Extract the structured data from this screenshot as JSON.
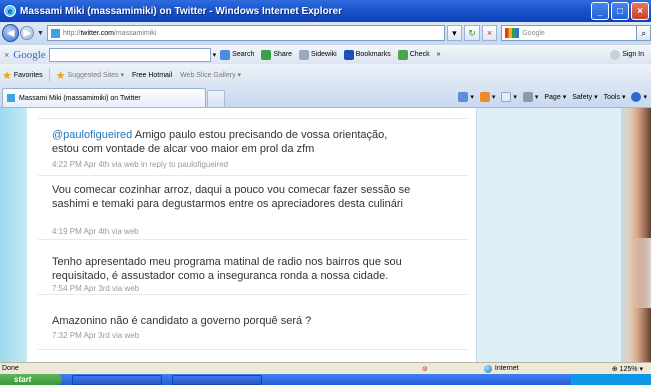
{
  "window": {
    "title": "Massami Miki (massamimiki) on Twitter - Windows Internet Explorer"
  },
  "address": {
    "url_prefix": "http://",
    "url_host": "twitter.com",
    "url_path": "/massamimiki",
    "search_placeholder": "Google"
  },
  "google_toolbar": {
    "logo": "Google",
    "items": [
      "Search",
      "Share",
      "Sidewiki",
      "Bookmarks",
      "Check",
      "»"
    ],
    "sign_in": "Sign In"
  },
  "favorites": {
    "label": "Favorites",
    "items": [
      "Suggested Sites",
      "Free Hotmail",
      "Web Slice Gallery"
    ]
  },
  "tab": {
    "title": "Massami Miki (massamimiki) on Twitter"
  },
  "command_bar": {
    "items": [
      "Page",
      "Safety",
      "Tools"
    ]
  },
  "tweets": [
    {
      "mention": "@paulofigueired",
      "text": " Amigo paulo estou precisando de vossa orientação, estou com vontade de alcar voo maior em prol da zfm",
      "meta": "4:22 PM Apr 4th via web in reply to paulofigueired"
    },
    {
      "mention": "",
      "text": "Vou comecar cozinhar arroz, daqui a pouco vou comecar fazer sessão se sashimi e temaki para degustarmos entre os apreciadores desta culinári",
      "meta": "4:19 PM Apr 4th via web"
    },
    {
      "mention": "",
      "text": "Tenho apresentado meu programa matinal de radio nos bairros que sou requisitado, é assustador como a inseguranca ronda a nossa cidade.",
      "meta": "7:54 PM Apr 3rd via web"
    },
    {
      "mention": "",
      "text": "Amazonino não é candidato a governo porquê será ?",
      "meta": "7:32 PM Apr 3rd via web"
    }
  ],
  "status": {
    "left": "Done",
    "zone": "Internet",
    "zoom": "125%"
  },
  "taskbar": {
    "start": "start"
  }
}
